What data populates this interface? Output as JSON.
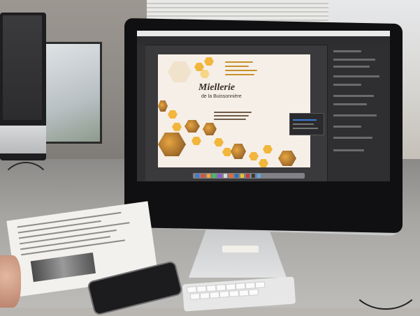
{
  "scene": {
    "artboard": {
      "brand_title": "Miellerie",
      "brand_subtitle": "de la Buissonnière"
    },
    "colors": {
      "honey": "#f2b63c",
      "artboard_bg": "#f6efe8",
      "ui_dark": "#303032"
    },
    "icons": [
      "apple-logo-icon",
      "bee-icon"
    ]
  }
}
